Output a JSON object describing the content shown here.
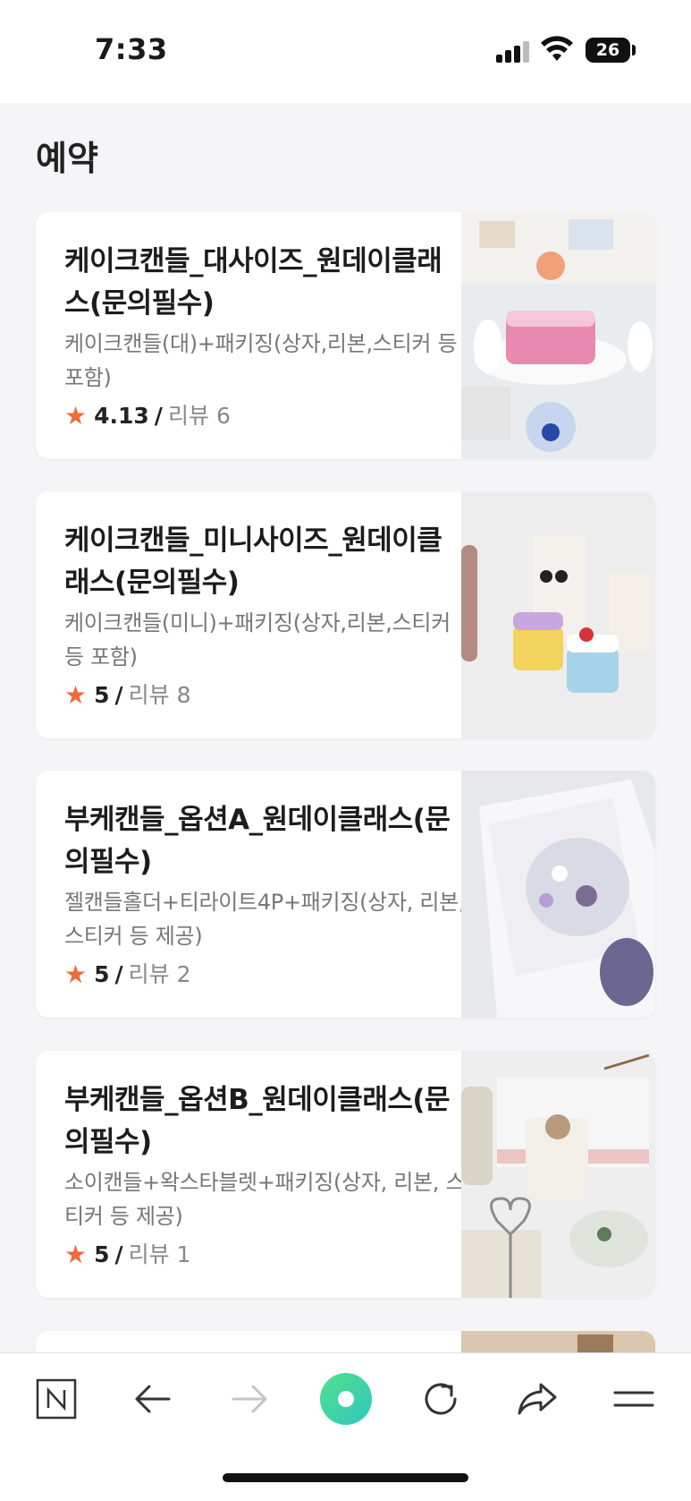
{
  "status": {
    "time": "7:33",
    "battery": "26"
  },
  "page": {
    "title": "예약"
  },
  "rating_label": "리뷰",
  "items": [
    {
      "title": "케이크캔들_대사이즈_원데이클래스(문의필수)",
      "desc": "케이크캔들(대)+패키징(상자,리본,스티커 등 포함)",
      "rating": "4.13",
      "reviews": "6"
    },
    {
      "title": "케이크캔들_미니사이즈_원데이클래스(문의필수)",
      "desc": "케이크캔들(미니)+패키징(상자,리본,스티커 등 포함)",
      "rating": "5",
      "reviews": "8"
    },
    {
      "title": "부케캔들_옵션A_원데이클래스(문의필수)",
      "desc": "젤캔들홀더+티라이트4P+패키징(상자, 리본, 스티커 등 제공)",
      "rating": "5",
      "reviews": "2"
    },
    {
      "title": "부케캔들_옵션B_원데이클래스(문의필수)",
      "desc": "소이캔들+왁스타블렛+패키징(상자, 리본, 스티커 등 제공)",
      "rating": "5",
      "reviews": "1"
    }
  ],
  "icons": {
    "naver": "naver-home-icon",
    "back": "arrow-left-icon",
    "forward": "arrow-right-icon",
    "green": "green-dot-icon",
    "reload": "reload-icon",
    "share": "share-icon",
    "menu": "menu-icon"
  },
  "colors": {
    "star": "#f06a3a",
    "accent_green": "#3ed6a0"
  }
}
